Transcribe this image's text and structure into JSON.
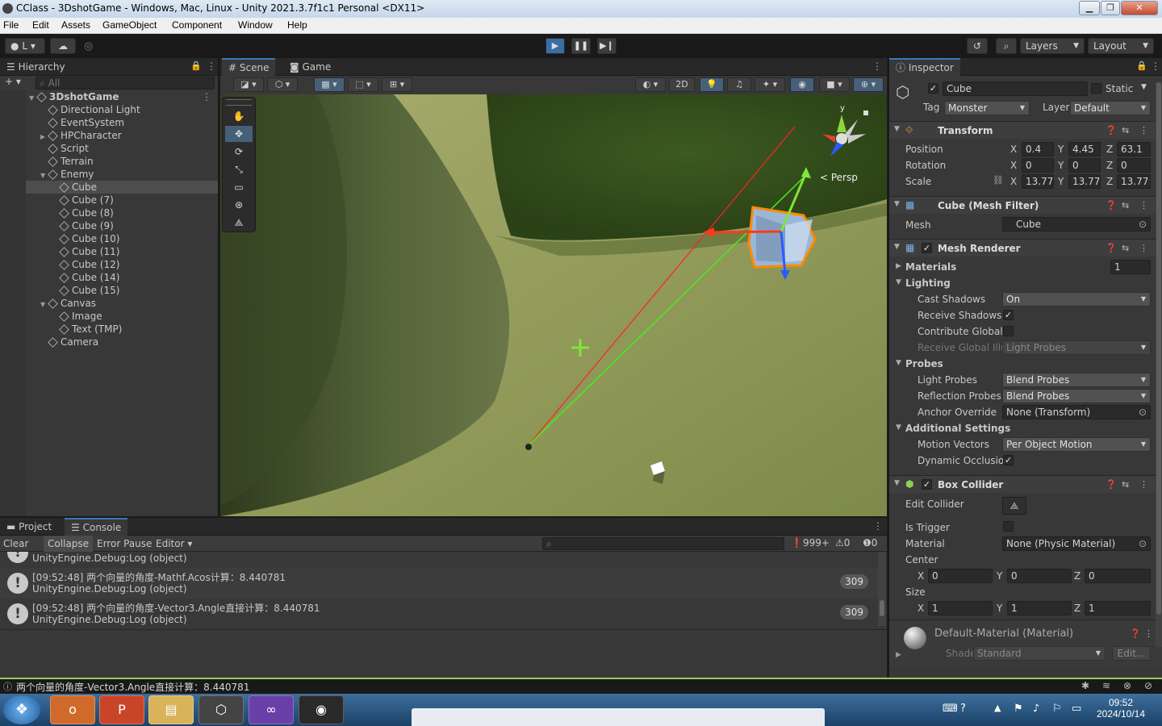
{
  "window": {
    "title": "CClass - 3DshotGame - Windows, Mac, Linux - Unity 2021.3.7f1c1 Personal <DX11>"
  },
  "menu": [
    "File",
    "Edit",
    "Assets",
    "GameObject",
    "Component",
    "Window",
    "Help"
  ],
  "toolbar": {
    "account_label": "L",
    "layers_label": "Layers",
    "layout_label": "Layout"
  },
  "hierarchy": {
    "tab": "Hierarchy",
    "search_placeholder": "All",
    "items": [
      {
        "label": "3DshotGame",
        "depth": 0,
        "kind": "scene",
        "expanded": true
      },
      {
        "label": "Directional Light",
        "depth": 1
      },
      {
        "label": "EventSystem",
        "depth": 1
      },
      {
        "label": "HPCharacter",
        "depth": 1,
        "collapsed": true
      },
      {
        "label": "Script",
        "depth": 1
      },
      {
        "label": "Terrain",
        "depth": 1
      },
      {
        "label": "Enemy",
        "depth": 1,
        "expanded": true
      },
      {
        "label": "Cube",
        "depth": 2,
        "selected": true
      },
      {
        "label": "Cube (7)",
        "depth": 2
      },
      {
        "label": "Cube (8)",
        "depth": 2
      },
      {
        "label": "Cube (9)",
        "depth": 2
      },
      {
        "label": "Cube (10)",
        "depth": 2
      },
      {
        "label": "Cube (11)",
        "depth": 2
      },
      {
        "label": "Cube (12)",
        "depth": 2
      },
      {
        "label": "Cube (14)",
        "depth": 2
      },
      {
        "label": "Cube (15)",
        "depth": 2
      },
      {
        "label": "Canvas",
        "depth": 1,
        "expanded": true
      },
      {
        "label": "Image",
        "depth": 2
      },
      {
        "label": "Text (TMP)",
        "depth": 2
      },
      {
        "label": "Camera",
        "depth": 1
      }
    ]
  },
  "scene": {
    "tabs": [
      "Scene",
      "Game"
    ],
    "btn_2d": "2D",
    "persp_label": "< Persp",
    "gizmo_y": "y"
  },
  "inspector": {
    "tab": "Inspector",
    "object_name": "Cube",
    "static_label": "Static",
    "tag_label": "Tag",
    "tag_value": "Monster",
    "layer_label": "Layer",
    "layer_value": "Default",
    "transform": {
      "title": "Transform",
      "position_label": "Position",
      "rotation_label": "Rotation",
      "scale_label": "Scale",
      "position": {
        "x": "0.4",
        "y": "4.45",
        "z": "63.1"
      },
      "rotation": {
        "x": "0",
        "y": "0",
        "z": "0"
      },
      "scale": {
        "x": "13.77:",
        "y": "13.77:",
        "z": "13.77:"
      }
    },
    "mesh_filter": {
      "title": "Cube (Mesh Filter)",
      "mesh_label": "Mesh",
      "mesh_value": "Cube"
    },
    "mesh_renderer": {
      "title": "Mesh Renderer",
      "materials_label": "Materials",
      "materials_count": "1",
      "lighting_label": "Lighting",
      "cast_shadows_label": "Cast Shadows",
      "cast_shadows_value": "On",
      "receive_shadows_label": "Receive Shadows",
      "contribute_gi_label": "Contribute Global I",
      "receive_gi_label": "Receive Global Illu",
      "receive_gi_value": "Light Probes",
      "probes_label": "Probes",
      "light_probes_label": "Light Probes",
      "light_probes_value": "Blend Probes",
      "reflection_probes_label": "Reflection Probes",
      "reflection_probes_value": "Blend Probes",
      "anchor_override_label": "Anchor Override",
      "anchor_override_value": "None (Transform)",
      "additional_label": "Additional Settings",
      "motion_vectors_label": "Motion Vectors",
      "motion_vectors_value": "Per Object Motion",
      "dynamic_occlusion_label": "Dynamic Occlusion"
    },
    "box_collider": {
      "title": "Box Collider",
      "edit_collider_label": "Edit Collider",
      "is_trigger_label": "Is Trigger",
      "material_label": "Material",
      "material_value": "None (Physic Material)",
      "center_label": "Center",
      "center": {
        "x": "0",
        "y": "0",
        "z": "0"
      },
      "size_label": "Size",
      "size": {
        "x": "1",
        "y": "1",
        "z": "1"
      }
    },
    "material": {
      "title": "Default-Material (Material)",
      "shader_label": "Shader",
      "shader_value": "Standard",
      "edit_label": "Edit..."
    }
  },
  "console": {
    "tabs": [
      "Project",
      "Console"
    ],
    "clear_label": "Clear",
    "collapse_label": "Collapse",
    "error_pause_label": "Error Pause",
    "editor_label": "Editor",
    "log_count": "999+",
    "warn_count": "0",
    "error_count": "0",
    "partial_row_text": "UnityEngine.Debug:Log (object)",
    "rows": [
      {
        "line1": "[09:52:48] 两个向量的角度-Mathf.Acos计算：8.440781",
        "line2": "UnityEngine.Debug:Log (object)",
        "count": "309"
      },
      {
        "line1": "[09:52:48] 两个向量的角度-Vector3.Angle直接计算：8.440781",
        "line2": "UnityEngine.Debug:Log (object)",
        "count": "309"
      }
    ]
  },
  "statusbar": {
    "message": "两个向量的角度-Vector3.Angle直接计算：8.440781"
  },
  "taskbar": {
    "time": "09:52",
    "date": "2024/10/14"
  }
}
